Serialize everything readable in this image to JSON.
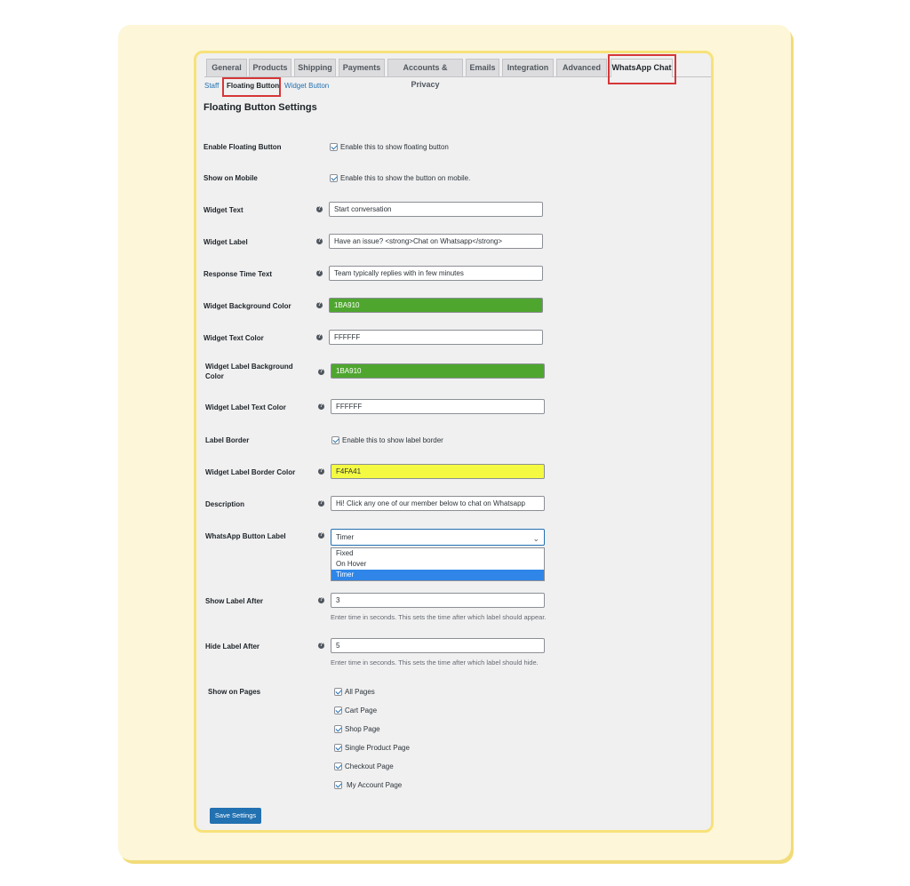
{
  "tabs": [
    "General",
    "Products",
    "Shipping",
    "Payments",
    "Accounts & Privacy",
    "Emails",
    "Integration",
    "Advanced",
    "WhatsApp Chat"
  ],
  "subnav": {
    "staff": "Staff",
    "floating": "Floating Button",
    "widget": "Widget Button"
  },
  "heading": "Floating Button Settings",
  "fields": {
    "enable_floating": {
      "label": "Enable Floating Button",
      "text": "Enable this to show floating button"
    },
    "show_mobile": {
      "label": "Show on Mobile",
      "text": "Enable this to show the button on mobile."
    },
    "widget_text": {
      "label": "Widget Text",
      "value": "Start conversation"
    },
    "widget_label": {
      "label": "Widget Label",
      "value": "Have an issue? <strong>Chat on Whatsapp</strong>"
    },
    "response_time": {
      "label": "Response Time Text",
      "value": "Team typically replies with in few minutes"
    },
    "widget_bg": {
      "label": "Widget Background Color",
      "value": "1BA910",
      "color": "#4fa62f"
    },
    "widget_text_color": {
      "label": "Widget Text Color",
      "value": "FFFFFF"
    },
    "label_bg": {
      "label": "Widget Label Background Color",
      "value": "1BA910",
      "color": "#4fa62f"
    },
    "label_text_color": {
      "label": "Widget Label Text Color",
      "value": "FFFFFF"
    },
    "label_border": {
      "label": "Label Border",
      "text": "Enable this to show label border"
    },
    "label_border_color": {
      "label": "Widget Label Border Color",
      "value": "F4FA41",
      "color": "#f4fa41"
    },
    "description": {
      "label": "Description",
      "value": "Hi! Click any one of our member below to chat on Whatsapp"
    },
    "button_label": {
      "label": "WhatsApp Button Label",
      "value": "Timer",
      "options": [
        "Fixed",
        "On Hover",
        "Timer"
      ]
    },
    "show_after": {
      "label": "Show Label After",
      "value": "3",
      "desc": "Enter time in seconds. This sets the time after which label should appear."
    },
    "hide_after": {
      "label": "Hide Label After",
      "value": "5",
      "desc": "Enter time in seconds. This sets the time after which label should hide."
    },
    "pages": {
      "label": "Show on Pages",
      "items": [
        "All Pages",
        "Cart Page",
        "Shop Page",
        "Single Product Page",
        "Checkout Page",
        "My Account Page"
      ]
    }
  },
  "save": "Save Settings",
  "help_glyph": "?",
  "chevron": "⌄"
}
